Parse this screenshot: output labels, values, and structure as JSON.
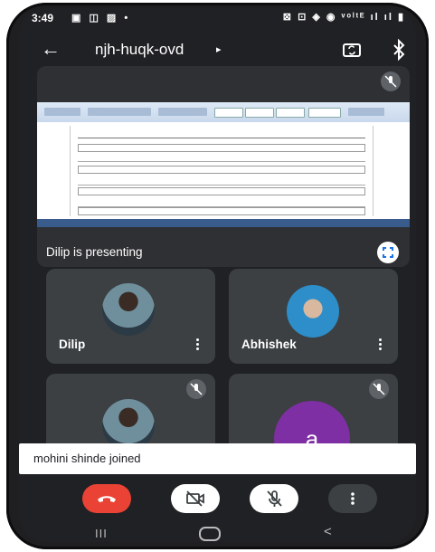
{
  "status_bar": {
    "time": "3:49",
    "left_icons": "▣ ◫ ▨ •",
    "right_icons": "⊠ ⊡ ◈ ◉ ᵛᵒˡᵗᴱ ıl ıl ▮"
  },
  "meeting": {
    "title": "njh-huqk-ovd",
    "title_caret": "▸"
  },
  "presentation": {
    "label": "Dilip is presenting"
  },
  "participants": [
    {
      "name": "Dilip",
      "avatar": "photo"
    },
    {
      "name": "Abhishek",
      "avatar": "photo"
    },
    {
      "name": "",
      "avatar": "photo"
    },
    {
      "name": "",
      "avatar_letter": "a"
    }
  ],
  "toast": {
    "message": "mohini shinde joined"
  },
  "colors": {
    "background": "#202124",
    "tile": "#3c4043",
    "end_call": "#ea4335",
    "letter_avatar": "#7e2fa3"
  },
  "nav": {
    "recents": "III",
    "back": "<"
  }
}
